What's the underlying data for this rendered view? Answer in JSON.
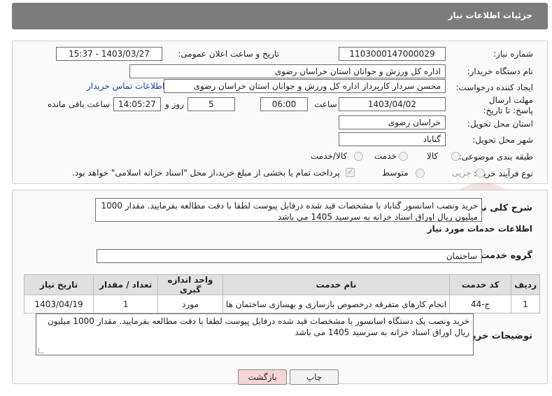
{
  "header": {
    "title": "جزئیات اطلاعات نیاز"
  },
  "form": {
    "need_number_label": "شماره نیاز:",
    "need_number": "1103000147000029",
    "announce_label": "تاریخ و ساعت اعلان عمومی:",
    "announce_value": "1403/03/27 - 15:37",
    "buyer_org_label": "نام دستگاه خریدار:",
    "buyer_org": "اداره کل ورزش و جوانان استان خراسان رضوی",
    "requester_label": "ایجاد کننده درخواست:",
    "requester": "محسن سردار کارپرداز اداره کل ورزش و جوانان استان خراسان رضوی",
    "contact_link": "اطلاعات تماس خریدار",
    "deadline_label": "مهلت ارسال پاسخ: تا تاریخ:",
    "deadline_date": "1403/04/02",
    "hour_label": "ساعت",
    "deadline_hour": "06:00",
    "days_value": "5",
    "days_label": "روز و",
    "remaining_time": "14:05:27",
    "remaining_label": "ساعت باقی مانده",
    "province_label": "استان محل تحویل:",
    "province": "خراسان رضوی",
    "city_label": "شهر محل تحویل:",
    "city": "گناباد",
    "category_label": "طبقه بندی موضوعی:",
    "category_options": [
      "کالا",
      "خدمت",
      "کالا/خدمت"
    ],
    "process_label": "نوع فرآیند خرید :",
    "process_options": [
      "جزیی",
      "متوسط"
    ],
    "payment_note": "پرداخت تمام یا بخشی از مبلغ خرید،از محل \"اسناد خزانه اسلامی\" خواهد بود."
  },
  "description": {
    "label": "شرح کلی نیاز:",
    "text": "خرید ونصب اسانسور گناباد با مشخصات قید شده درفایل پیوست لطفا با دقت مطالعه بفرمایید. مقدار 1000 میلیون ریال اوراق اسناد خزانه به سرسید 1405 می باشد"
  },
  "services": {
    "section_title": "اطلاعات خدمات مورد نیاز",
    "group_label": "گروه خدمت:",
    "group_value": "ساختمان",
    "columns": [
      "ردیف",
      "کد خدمت",
      "نام خدمت",
      "واحد اندازه گیری",
      "تعداد / مقدار",
      "تاریخ نیاز"
    ],
    "rows": [
      [
        "1",
        "ج-44",
        "انجام کارهای متفرقه درخصوص بازسازی و بهسازی ساختمان ها",
        "مورد",
        "1",
        "1403/04/19"
      ]
    ]
  },
  "buyer_notes": {
    "label": "توضیحات خریدار:",
    "text": "خرید ونصب یک دستگاه اسانسور با مشخصات قید شده درفایل پیوست لطفا با دقت مطالعه بفرمایید. مقدار 1000 میلیون ریال اوراق اسناد خزانه به سرسید 1405 می باشد"
  },
  "buttons": {
    "print": "چاپ",
    "back": "بازگشت"
  },
  "colors": {
    "header_bg": "#7c7c7c",
    "back_button_bg": "#f6d5d5",
    "link": "#1a46b0"
  },
  "icons": {
    "watermark": "ariatender-watermark"
  }
}
